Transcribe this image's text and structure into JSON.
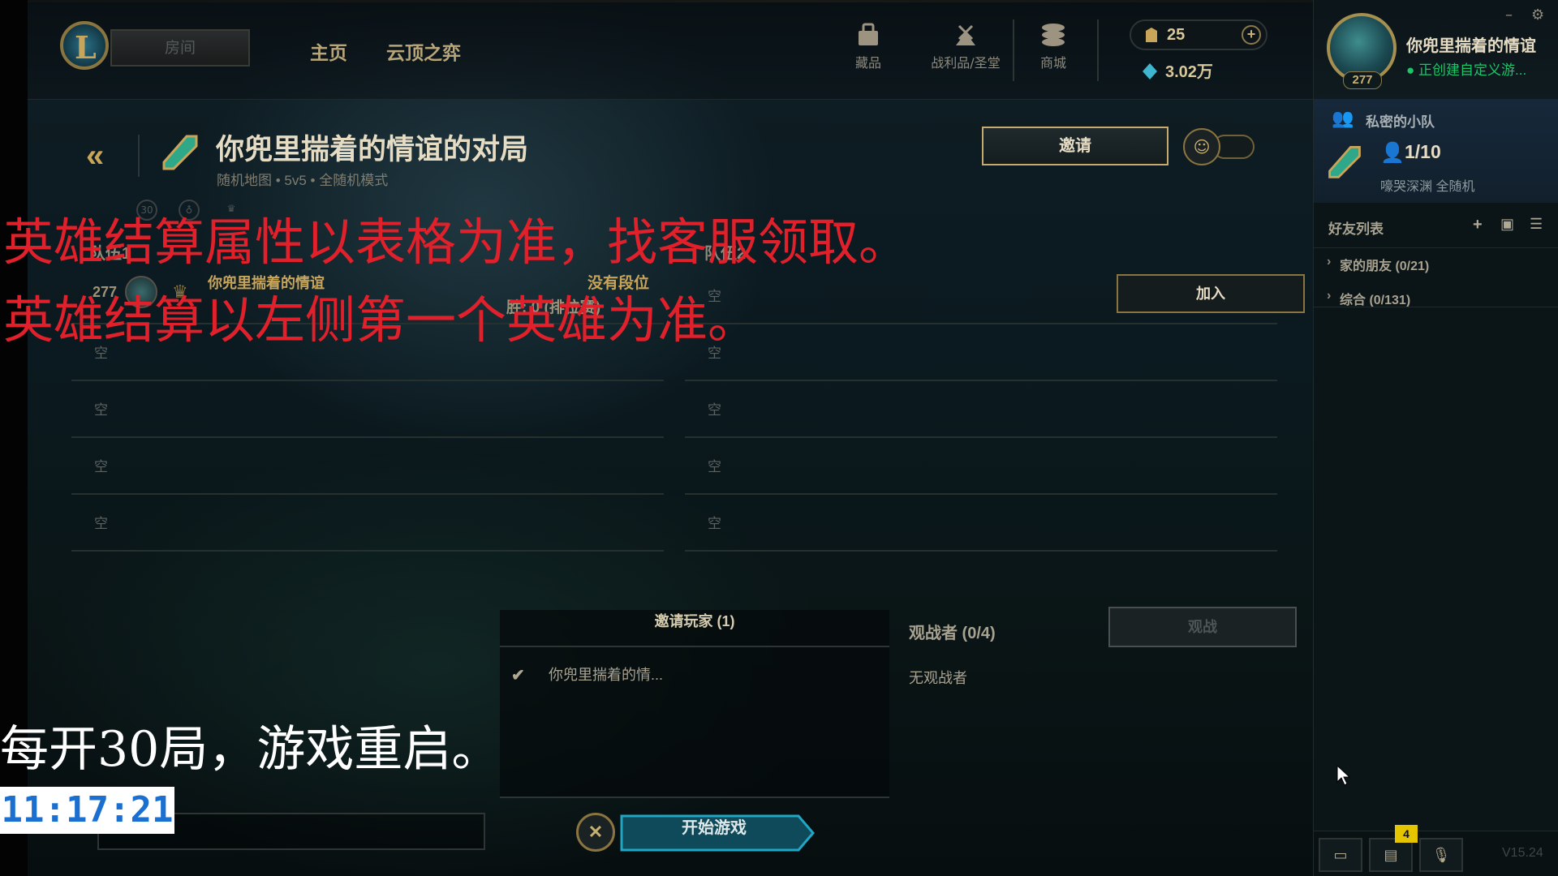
{
  "header": {
    "play_button": "房间",
    "nav_tabs": [
      "主页",
      "云顶之弈"
    ],
    "icons": [
      {
        "name": "collection-icon",
        "label": "藏品"
      },
      {
        "name": "loot-icon",
        "label": "战利品/圣堂"
      },
      {
        "name": "store-icon",
        "label": "商城"
      }
    ],
    "riot_points": "25",
    "blue_essence": "3.02万"
  },
  "profile": {
    "level": "277",
    "name": "你兜里揣着的情谊",
    "status": "正创建自定义游..."
  },
  "party": {
    "title": "私密的小队",
    "count": "1/10",
    "mode": "嚎哭深渊 全随机"
  },
  "friends": {
    "title": "好友列表",
    "groups": [
      {
        "label": "家的朋友 (0/21)"
      },
      {
        "label": "综合 (0/131)"
      }
    ]
  },
  "lobby": {
    "title": "你兜里揣着的情谊的对局",
    "subtitle": "随机地图 • 5v5 • 全随机模式",
    "invite_button": "邀请",
    "team1_label": "队伍1",
    "team2_label": "队伍2",
    "player1": {
      "level": "277",
      "name": "你兜里揣着的情谊",
      "rank": "没有段位",
      "stats": "胜: 0 (排位赛)"
    },
    "empty_slot": "空",
    "join_button": "加入"
  },
  "invites": {
    "header": "邀请玩家 (1)",
    "player": "你兜里揣着的情..."
  },
  "spectators": {
    "header": "观战者 (0/4)",
    "none": "无观战者",
    "button": "观战"
  },
  "footer": {
    "start_button": "开始游戏",
    "cancel_icon": "✕",
    "chat_badge": "4",
    "version": "V15.24"
  },
  "overlays": {
    "line1": "英雄结算属性以表格为准，找客服领取。",
    "line2": "英雄结算以左侧第一个英雄为准。",
    "line3": "每开30局，游戏重启。",
    "clock": "11:17:21"
  },
  "colors": {
    "gold": "#c8aa6e",
    "overlay_red": "#e0202a",
    "status_green": "#1ec36a",
    "clock_blue": "#1a6fd0"
  }
}
